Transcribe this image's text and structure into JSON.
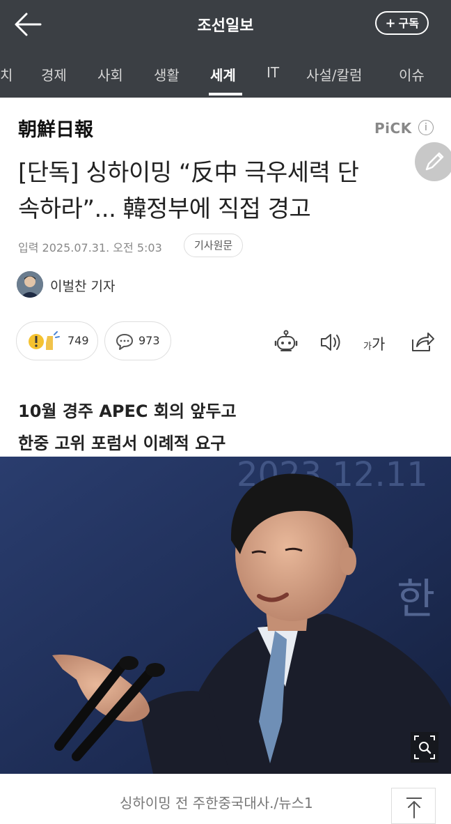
{
  "header": {
    "brand": "조선일보",
    "subscribe_label": "구독"
  },
  "tabs": [
    {
      "label": "치"
    },
    {
      "label": "경제"
    },
    {
      "label": "사회"
    },
    {
      "label": "생활"
    },
    {
      "label": "세계",
      "active": true
    },
    {
      "label": "IT"
    },
    {
      "label": "사설/칼럼"
    },
    {
      "label": "이슈"
    }
  ],
  "article": {
    "logo_text": "朝鮮日報",
    "pick_label": "PiCK",
    "pick_info": "i",
    "headline_line1": "[단독] 싱하이밍 “反中 극우세력 단",
    "headline_line2": "속하라”... 韓정부에 직접 경고",
    "date": "입력 2025.07.31. 오전 5:03",
    "source_button": "기사원문",
    "author": "이벌찬 기자",
    "reaction_count": "749",
    "comment_count": "973",
    "fontsize_label_small": "가",
    "fontsize_label_large": "가",
    "subhead_line1": "10월 경주 APEC 회의 앞두고",
    "subhead_line2": "한중 고위 포럼서 이례적 요구",
    "photo_backdrop_text": "2023.12.11",
    "photo_backdrop_text2": "한",
    "photo_caption": "싱하이밍 전 주한중국대사./뉴스1"
  },
  "colors": {
    "header_bg": "#3b3f44",
    "active_tab": "#ffffff"
  },
  "icons": [
    "back-arrow-icon",
    "plus-icon",
    "edit-pencil-icon",
    "reaction-icon",
    "comment-icon",
    "robot-summary-icon",
    "speaker-icon",
    "share-icon",
    "zoom-icon",
    "scroll-top-icon"
  ]
}
